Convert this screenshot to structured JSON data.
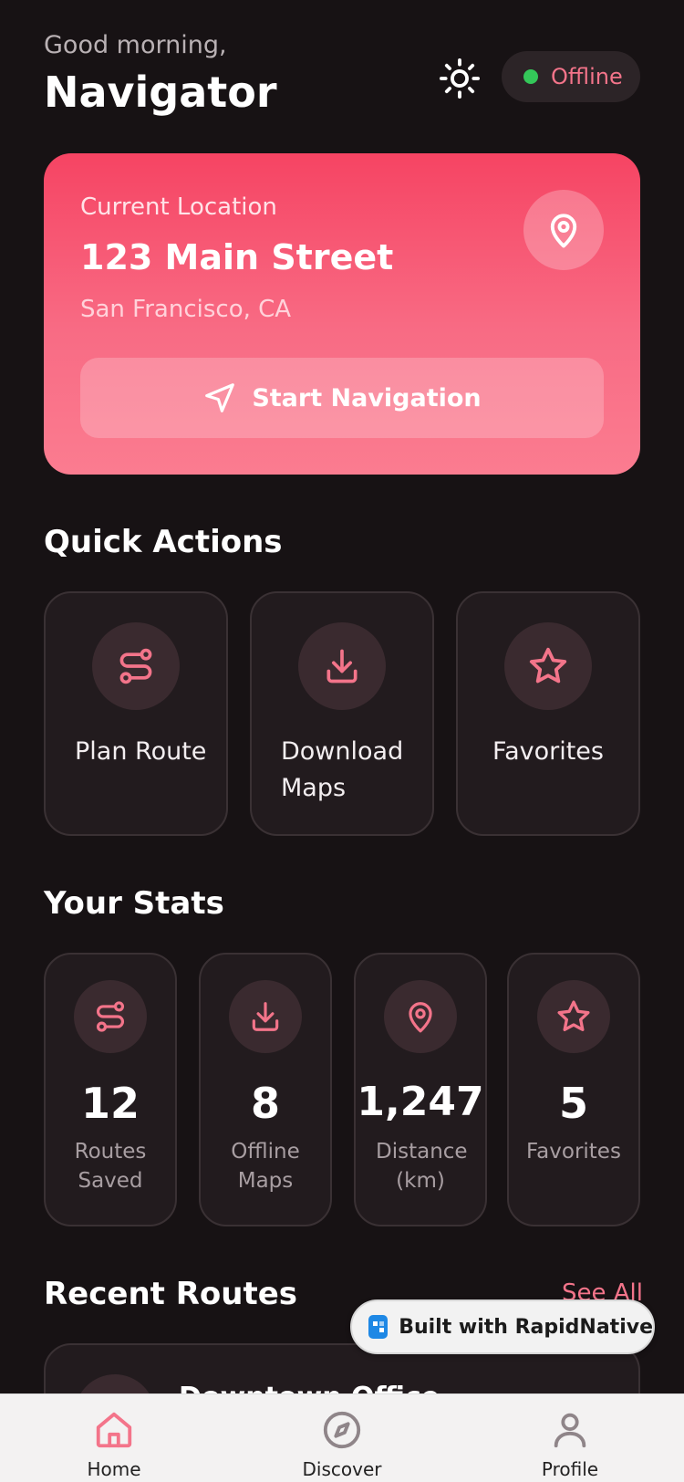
{
  "header": {
    "greeting": "Good morning,",
    "username": "Navigator",
    "status": "Offline"
  },
  "location": {
    "label": "Current Location",
    "street": "123 Main Street",
    "city": "San Francisco, CA",
    "button_label": "Start Navigation"
  },
  "quick_actions": {
    "title": "Quick Actions",
    "items": [
      {
        "label": "Plan Route",
        "icon": "route-icon"
      },
      {
        "label": "Download Maps",
        "icon": "download-icon"
      },
      {
        "label": "Favorites",
        "icon": "star-icon"
      }
    ]
  },
  "stats": {
    "title": "Your Stats",
    "items": [
      {
        "value": "12",
        "label": "Routes Saved",
        "icon": "route-icon"
      },
      {
        "value": "8",
        "label": "Offline Maps",
        "icon": "download-icon"
      },
      {
        "value": "1,247",
        "label": "Distance (km)",
        "icon": "map-pin-icon"
      },
      {
        "value": "5",
        "label": "Favorites",
        "icon": "star-icon"
      }
    ]
  },
  "recent_routes": {
    "title": "Recent Routes",
    "see_all": "See All",
    "items": [
      {
        "title": "Downtown Office"
      }
    ]
  },
  "badge": {
    "text": "Built with RapidNative"
  },
  "tabs": [
    {
      "label": "Home",
      "icon": "home-icon",
      "active": true
    },
    {
      "label": "Discover",
      "icon": "compass-icon",
      "active": false
    },
    {
      "label": "Profile",
      "icon": "user-icon",
      "active": false
    }
  ],
  "colors": {
    "accent": "#f3748a",
    "background": "#171214",
    "card": "#221b1e",
    "status_online": "#34c759"
  }
}
